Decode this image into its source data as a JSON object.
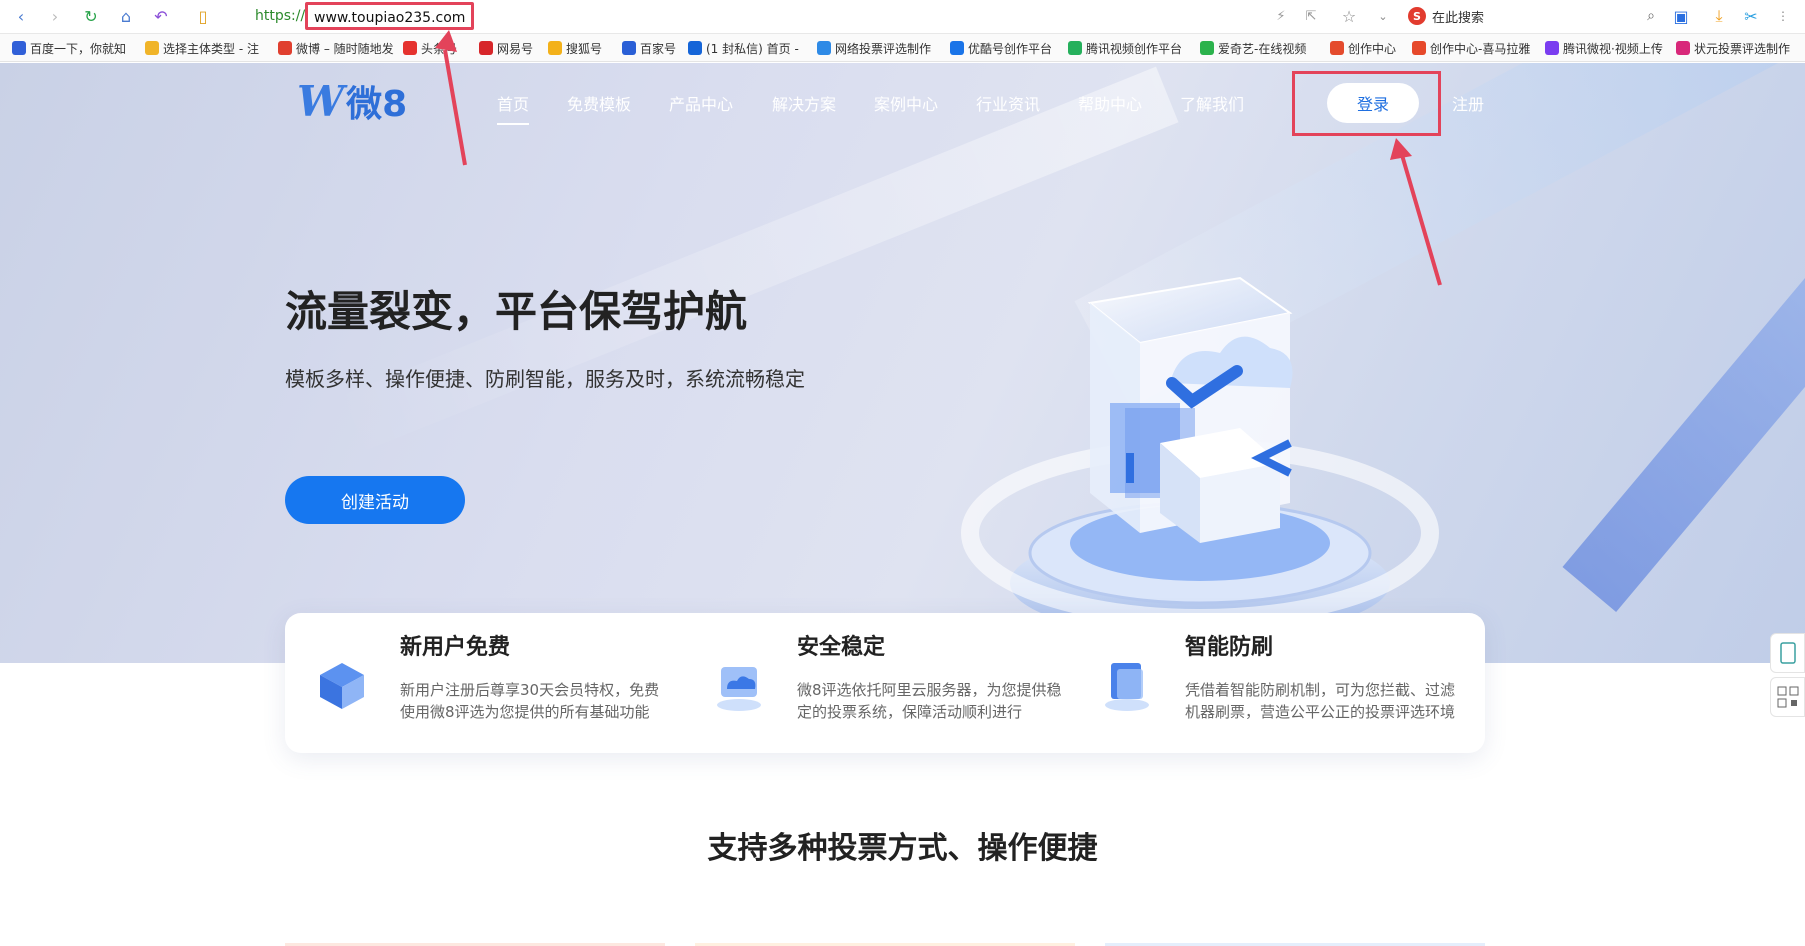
{
  "browser": {
    "address_protocol": "https://",
    "address_host": "www.toupiao235.com",
    "search_placeholder": "在此搜索",
    "bookmarks": [
      {
        "label": "百度一下，你就知",
        "color": "#3160d8"
      },
      {
        "label": "选择主体类型 - 注",
        "color": "#f0b429"
      },
      {
        "label": "微博 – 随时随地发",
        "color": "#e03f2f"
      },
      {
        "label": "头条号",
        "color": "#e5322e"
      },
      {
        "label": "网易号",
        "color": "#d7262a"
      },
      {
        "label": "搜狐号",
        "color": "#f3b11a"
      },
      {
        "label": "百家号",
        "color": "#2a5fd6"
      },
      {
        "label": "(1 封私信) 首页 -",
        "color": "#1565d8"
      },
      {
        "label": "网络投票评选制作",
        "color": "#2e8ae6"
      },
      {
        "label": "优酷号创作平台",
        "color": "#1a74e8"
      },
      {
        "label": "腾讯视频创作平台",
        "color": "#25b05c"
      },
      {
        "label": "爱奇艺-在线视频",
        "color": "#2bb24c"
      },
      {
        "label": "创作中心",
        "color": "#e44b2d"
      },
      {
        "label": "创作中心-喜马拉雅",
        "color": "#e6492b"
      },
      {
        "label": "腾讯微视·视频上传",
        "color": "#7a3df0"
      },
      {
        "label": "状元投票评选制作",
        "color": "#d8287a"
      }
    ]
  },
  "site": {
    "logo_letter": "W",
    "logo_text": "微8",
    "nav": [
      "首页",
      "免费模板",
      "产品中心",
      "解决方案",
      "案例中心",
      "行业资讯",
      "帮助中心",
      "了解我们"
    ],
    "login": "登录",
    "register": "注册"
  },
  "hero": {
    "title": "流量裂变，平台保驾护航",
    "subtitle": "模板多样、操作便捷、防刷智能，服务及时，系统流畅稳定",
    "cta": "创建活动"
  },
  "features": [
    {
      "title": "新用户免费",
      "desc": "新用户注册后尊享30天会员特权，免费使用微8评选为您提供的所有基础功能",
      "icon": "cube-stack-icon"
    },
    {
      "title": "安全稳定",
      "desc": "微8评选依托阿里云服务器，为您提供稳定的投票系统，保障活动顺利进行",
      "icon": "cloud-server-icon"
    },
    {
      "title": "智能防刷",
      "desc": "凭借着智能防刷机制，可为您拦截、过滤机器刷票，营造公平公正的投票评选环境",
      "icon": "shield-screen-icon"
    }
  ],
  "section_title": "支持多种投票方式、操作便捷",
  "colors": {
    "accent": "#1677f0",
    "annotation": "#e3435a"
  }
}
